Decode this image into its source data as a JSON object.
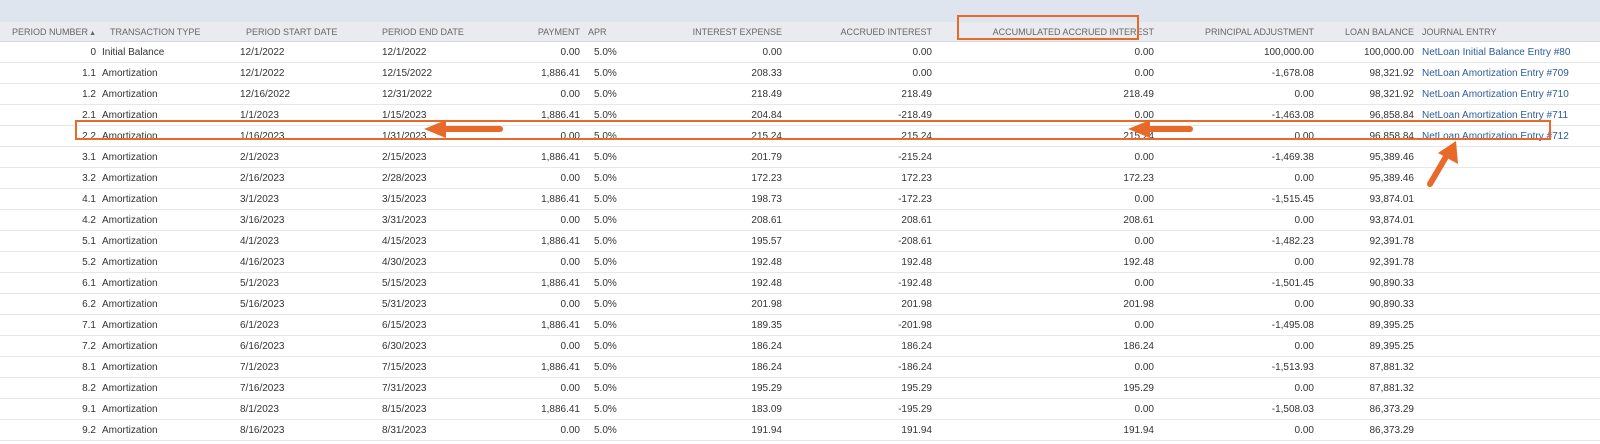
{
  "table": {
    "sort_indicator": "▲",
    "columns": [
      {
        "key": "period",
        "label": "PERIOD NUMBER"
      },
      {
        "key": "type",
        "label": "TRANSACTION TYPE"
      },
      {
        "key": "start",
        "label": "PERIOD START DATE"
      },
      {
        "key": "end",
        "label": "PERIOD END DATE"
      },
      {
        "key": "payment",
        "label": "PAYMENT"
      },
      {
        "key": "apr",
        "label": "APR"
      },
      {
        "key": "interest",
        "label": "INTEREST EXPENSE"
      },
      {
        "key": "accrued",
        "label": "ACCRUED INTEREST"
      },
      {
        "key": "accum",
        "label": "ACCUMULATED ACCRUED INTEREST"
      },
      {
        "key": "principal",
        "label": "PRINCIPAL ADJUSTMENT"
      },
      {
        "key": "balance",
        "label": "LOAN BALANCE"
      },
      {
        "key": "journal",
        "label": "JOURNAL ENTRY"
      }
    ],
    "rows": [
      [
        "0",
        "Initial Balance",
        "12/1/2022",
        "12/1/2022",
        "0.00",
        "5.0%",
        "0.00",
        "0.00",
        "0.00",
        "100,000.00",
        "100,000.00",
        "NetLoan Initial Balance Entry #80"
      ],
      [
        "1.1",
        "Amortization",
        "12/1/2022",
        "12/15/2022",
        "1,886.41",
        "5.0%",
        "208.33",
        "0.00",
        "0.00",
        "-1,678.08",
        "98,321.92",
        "NetLoan Amortization Entry #709"
      ],
      [
        "1.2",
        "Amortization",
        "12/16/2022",
        "12/31/2022",
        "0.00",
        "5.0%",
        "218.49",
        "218.49",
        "218.49",
        "0.00",
        "98,321.92",
        "NetLoan Amortization Entry #710"
      ],
      [
        "2.1",
        "Amortization",
        "1/1/2023",
        "1/15/2023",
        "1,886.41",
        "5.0%",
        "204.84",
        "-218.49",
        "0.00",
        "-1,463.08",
        "96,858.84",
        "NetLoan Amortization Entry #711"
      ],
      [
        "2.2",
        "Amortization",
        "1/16/2023",
        "1/31/2023",
        "0.00",
        "5.0%",
        "215.24",
        "215.24",
        "215.24",
        "0.00",
        "96,858.84",
        "NetLoan Amortization Entry #712"
      ],
      [
        "3.1",
        "Amortization",
        "2/1/2023",
        "2/15/2023",
        "1,886.41",
        "5.0%",
        "201.79",
        "-215.24",
        "0.00",
        "-1,469.38",
        "95,389.46",
        ""
      ],
      [
        "3.2",
        "Amortization",
        "2/16/2023",
        "2/28/2023",
        "0.00",
        "5.0%",
        "172.23",
        "172.23",
        "172.23",
        "0.00",
        "95,389.46",
        ""
      ],
      [
        "4.1",
        "Amortization",
        "3/1/2023",
        "3/15/2023",
        "1,886.41",
        "5.0%",
        "198.73",
        "-172.23",
        "0.00",
        "-1,515.45",
        "93,874.01",
        ""
      ],
      [
        "4.2",
        "Amortization",
        "3/16/2023",
        "3/31/2023",
        "0.00",
        "5.0%",
        "208.61",
        "208.61",
        "208.61",
        "0.00",
        "93,874.01",
        ""
      ],
      [
        "5.1",
        "Amortization",
        "4/1/2023",
        "4/15/2023",
        "1,886.41",
        "5.0%",
        "195.57",
        "-208.61",
        "0.00",
        "-1,482.23",
        "92,391.78",
        ""
      ],
      [
        "5.2",
        "Amortization",
        "4/16/2023",
        "4/30/2023",
        "0.00",
        "5.0%",
        "192.48",
        "192.48",
        "192.48",
        "0.00",
        "92,391.78",
        ""
      ],
      [
        "6.1",
        "Amortization",
        "5/1/2023",
        "5/15/2023",
        "1,886.41",
        "5.0%",
        "192.48",
        "-192.48",
        "0.00",
        "-1,501.45",
        "90,890.33",
        ""
      ],
      [
        "6.2",
        "Amortization",
        "5/16/2023",
        "5/31/2023",
        "0.00",
        "5.0%",
        "201.98",
        "201.98",
        "201.98",
        "0.00",
        "90,890.33",
        ""
      ],
      [
        "7.1",
        "Amortization",
        "6/1/2023",
        "6/15/2023",
        "1,886.41",
        "5.0%",
        "189.35",
        "-201.98",
        "0.00",
        "-1,495.08",
        "89,395.25",
        ""
      ],
      [
        "7.2",
        "Amortization",
        "6/16/2023",
        "6/30/2023",
        "0.00",
        "5.0%",
        "186.24",
        "186.24",
        "186.24",
        "0.00",
        "89,395.25",
        ""
      ],
      [
        "8.1",
        "Amortization",
        "7/1/2023",
        "7/15/2023",
        "1,886.41",
        "5.0%",
        "186.24",
        "-186.24",
        "0.00",
        "-1,513.93",
        "87,881.32",
        ""
      ],
      [
        "8.2",
        "Amortization",
        "7/16/2023",
        "7/31/2023",
        "0.00",
        "5.0%",
        "195.29",
        "195.29",
        "195.29",
        "0.00",
        "87,881.32",
        ""
      ],
      [
        "9.1",
        "Amortization",
        "8/1/2023",
        "8/15/2023",
        "1,886.41",
        "5.0%",
        "183.09",
        "-195.29",
        "0.00",
        "-1,508.03",
        "86,373.29",
        ""
      ],
      [
        "9.2",
        "Amortization",
        "8/16/2023",
        "8/31/2023",
        "0.00",
        "5.0%",
        "191.94",
        "191.94",
        "191.94",
        "0.00",
        "86,373.29",
        ""
      ]
    ]
  },
  "annotations": {
    "color": "#e86a2b",
    "highlighted_column": "ACCUMULATED ACCRUED INTEREST",
    "highlighted_row": "2.2"
  }
}
